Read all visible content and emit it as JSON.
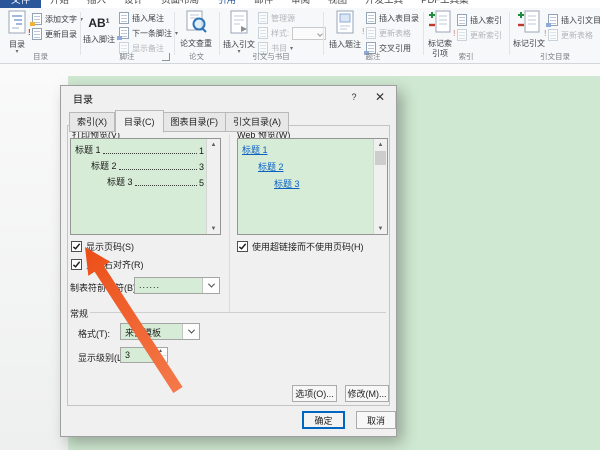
{
  "ribbon": {
    "tabs": [
      "文件",
      "开始",
      "插入",
      "设计",
      "页面布局",
      "引用",
      "邮件",
      "审阅",
      "视图",
      "开发工具",
      "PDF工具集"
    ],
    "active_tab": "引用",
    "groups": [
      {
        "label": "目录",
        "big": "目录",
        "items": [
          "添加文字",
          "更新目录"
        ]
      },
      {
        "label": "脚注",
        "big": "插入脚注",
        "glyph": "AB¹",
        "items": [
          "插入尾注",
          "下一条脚注",
          "显示备注"
        ]
      },
      {
        "label": "论文",
        "big": "论文查重",
        "items": []
      },
      {
        "label": "引文与书目",
        "big": "插入引文",
        "items": [
          "管理源",
          "样式:",
          "书目"
        ]
      },
      {
        "label": "题注",
        "big": "插入题注",
        "items": [
          "插入表目录",
          "更新表格",
          "交叉引用"
        ]
      },
      {
        "label": "索引",
        "big": "标记索引项",
        "items": [
          "插入索引",
          "更新索引"
        ]
      },
      {
        "label": "引文目录",
        "big": "标记引文",
        "items": [
          "插入引文目录",
          "更新表格"
        ]
      }
    ]
  },
  "dialog": {
    "title": "目录",
    "help": "?",
    "close": "✕",
    "tabs": [
      "索引(X)",
      "目录(C)",
      "图表目录(F)",
      "引文目录(A)"
    ],
    "active_tab": "目录(C)",
    "print_preview": {
      "label": "打印预览(V)",
      "entries": [
        {
          "text": "标题 1",
          "page": "1"
        },
        {
          "text": "标题 2",
          "page": "3"
        },
        {
          "text": "标题 3",
          "page": "5"
        }
      ]
    },
    "web_preview": {
      "label": "Web 预览(W)",
      "entries": [
        {
          "text": "标题 1"
        },
        {
          "text": "标题 2"
        },
        {
          "text": "标题 3"
        }
      ]
    },
    "options": {
      "show_page_numbers": {
        "label": "显示页码(S)",
        "checked": true
      },
      "right_align_page_numbers": {
        "label": "页码右对齐(R)",
        "checked": true
      },
      "tab_leader": {
        "label": "制表符前导符(B):",
        "value": "......"
      },
      "use_hyperlinks": {
        "label": "使用超链接而不使用页码(H)",
        "checked": true
      }
    },
    "general": {
      "label": "常规",
      "format": {
        "label": "格式(T):",
        "value": "来自模板"
      },
      "show_levels": {
        "label": "显示级别(L):",
        "value": "3"
      }
    },
    "buttons": {
      "options": "选项(O)...",
      "modify": "修改(M)...",
      "ok": "确定",
      "cancel": "取消"
    }
  },
  "colors": {
    "accent_blue": "#2b579a",
    "page_green": "#cfe8d1",
    "field_green": "#d6ecd7",
    "arrow_orange": "#f15a29",
    "link_blue": "#0b61c4",
    "default_button_border": "#0067c0"
  }
}
